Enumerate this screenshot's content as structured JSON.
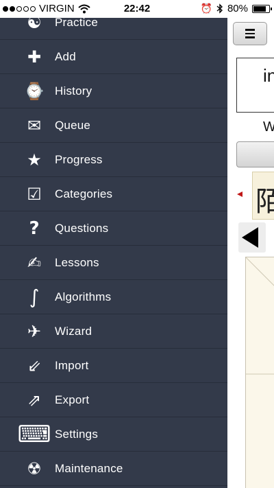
{
  "status_bar": {
    "carrier": "VIRGIN",
    "time": "22:42",
    "battery": "80%",
    "battery_level": 0.8
  },
  "menu": {
    "items": [
      {
        "label": "Practice",
        "icon": "yin-yang-icon",
        "glyph": "☯"
      },
      {
        "label": "Add",
        "icon": "plus-icon",
        "glyph": "✚"
      },
      {
        "label": "History",
        "icon": "watch-icon",
        "glyph": "⌚"
      },
      {
        "label": "Queue",
        "icon": "envelope-icon",
        "glyph": "✉"
      },
      {
        "label": "Progress",
        "icon": "star-icon",
        "glyph": "★"
      },
      {
        "label": "Categories",
        "icon": "checkbox-icon",
        "glyph": "☑"
      },
      {
        "label": "Questions",
        "icon": "question-icon",
        "glyph": "?"
      },
      {
        "label": "Lessons",
        "icon": "pen-icon",
        "glyph": "✍"
      },
      {
        "label": "Algorithms",
        "icon": "integral-icon",
        "glyph": "∫"
      },
      {
        "label": "Wizard",
        "icon": "airplane-icon",
        "glyph": "✈"
      },
      {
        "label": "Import",
        "icon": "arrow-down-left-icon",
        "glyph": "⇙"
      },
      {
        "label": "Export",
        "icon": "arrow-up-right-icon",
        "glyph": "⇗"
      },
      {
        "label": "Settings",
        "icon": "keyboard-icon",
        "glyph": "⌨"
      },
      {
        "label": "Maintenance",
        "icon": "radiation-icon",
        "glyph": "☢"
      }
    ]
  },
  "main": {
    "prompt_text": "in",
    "sub_letter": "W",
    "character": "陌"
  }
}
